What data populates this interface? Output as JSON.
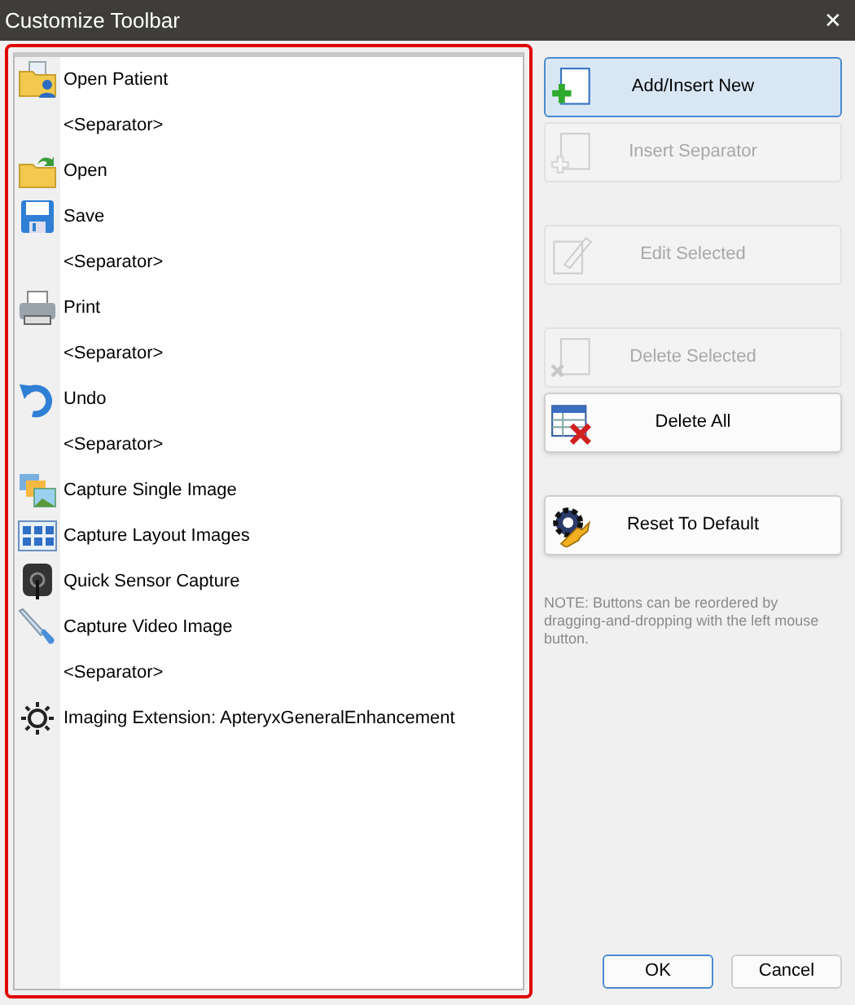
{
  "window": {
    "title": "Customize Toolbar",
    "close": "✕"
  },
  "items": [
    {
      "kind": "command",
      "label": "Open Patient"
    },
    {
      "kind": "separator",
      "label": "<Separator>"
    },
    {
      "kind": "command",
      "label": "Open"
    },
    {
      "kind": "command",
      "label": "Save"
    },
    {
      "kind": "separator",
      "label": "<Separator>"
    },
    {
      "kind": "command",
      "label": "Print"
    },
    {
      "kind": "separator",
      "label": "<Separator>"
    },
    {
      "kind": "command",
      "label": "Undo"
    },
    {
      "kind": "separator",
      "label": "<Separator>"
    },
    {
      "kind": "command",
      "label": "Capture Single Image"
    },
    {
      "kind": "command",
      "label": "Capture Layout Images"
    },
    {
      "kind": "command",
      "label": "Quick Sensor Capture"
    },
    {
      "kind": "command",
      "label": "Capture Video Image"
    },
    {
      "kind": "separator",
      "label": "<Separator>"
    },
    {
      "kind": "command",
      "label": "Imaging Extension: ApteryxGeneralEnhancement"
    }
  ],
  "actions": [
    {
      "label": "Add/Insert New",
      "disabled": false,
      "focused": true
    },
    {
      "label": "Insert Separator",
      "disabled": true,
      "focused": false
    },
    {
      "label": "Edit Selected",
      "disabled": true,
      "focused": false
    },
    {
      "label": "Delete Selected",
      "disabled": true,
      "focused": false
    },
    {
      "label": "Delete All",
      "disabled": false,
      "focused": false
    },
    {
      "label": "Reset To Default",
      "disabled": false,
      "focused": false
    }
  ],
  "note": "NOTE: Buttons can be reordered by dragging-and-dropping with the left mouse button.",
  "buttons": [
    {
      "label": "OK",
      "focused": true
    },
    {
      "label": "Cancel",
      "focused": false
    }
  ]
}
